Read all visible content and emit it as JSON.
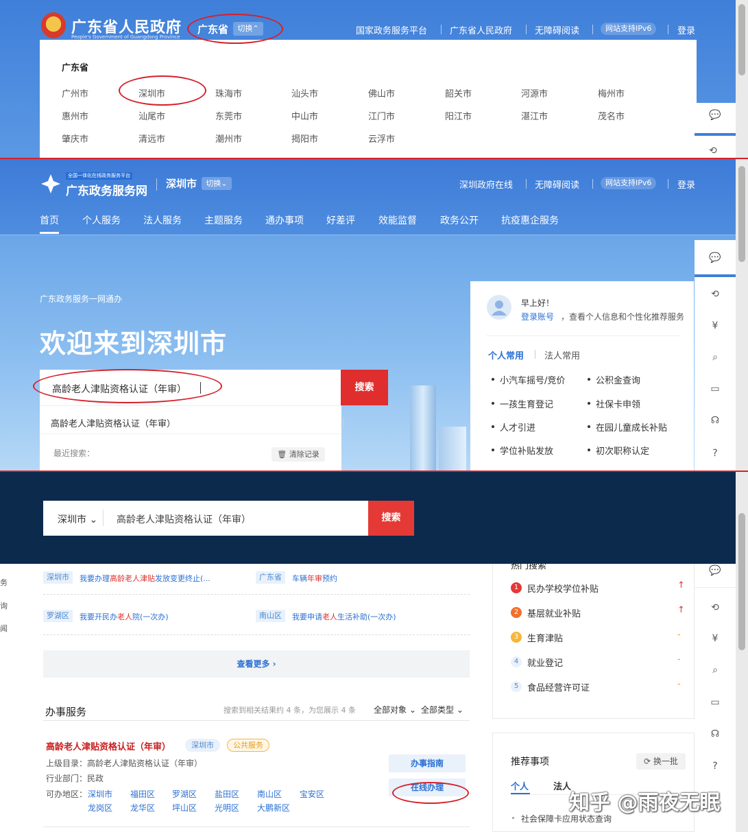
{
  "panel1": {
    "logo_title": "广东省人民政府",
    "logo_subtitle": "People's Government of Guangdong Province",
    "province_label": "广东省",
    "switch_label": "切换",
    "top_nav": [
      "国家政务服务平台",
      "广东省人民政府",
      "无障碍阅读",
      "网站支持IPv6",
      "登录"
    ],
    "dropdown_title": "广东省",
    "cities": [
      [
        "广州市",
        "深圳市",
        "珠海市",
        "汕头市",
        "佛山市",
        "韶关市",
        "河源市",
        "梅州市"
      ],
      [
        "惠州市",
        "汕尾市",
        "东莞市",
        "中山市",
        "江门市",
        "阳江市",
        "湛江市",
        "茂名市"
      ],
      [
        "肇庆市",
        "清远市",
        "潮州市",
        "揭阳市",
        "云浮市"
      ]
    ]
  },
  "panel2": {
    "logo_badge": "全国一体化在线政务服务平台",
    "logo_title": "广东政务服务网",
    "city": "深圳市",
    "switch_label": "切换",
    "top_nav": [
      "深圳政府在线",
      "无障碍阅读",
      "网站支持IPv6",
      "登录"
    ],
    "main_nav": [
      "首页",
      "个人服务",
      "法人服务",
      "主题服务",
      "通办事项",
      "好差评",
      "效能监督",
      "政务公开",
      "抗疫惠企服务"
    ],
    "slogan": "广东政务服务一网通办",
    "welcome": "欢迎来到深圳市",
    "search_value": "高龄老人津贴资格认证（年审）",
    "search_button": "搜索",
    "suggestion": "高龄老人津贴资格认证（年审）",
    "recent_label": "最近搜索：",
    "clear_label": "清除记录",
    "greeting": "早上好！",
    "login_link": "登录账号",
    "login_text": "，查看个人信息和个性化推荐服务",
    "tabs": [
      "个人常用",
      "法人常用"
    ],
    "quick_items": [
      "小汽车摇号/竞价",
      "公积金查询",
      "一孩生育登记",
      "社保卡申领",
      "人才引进",
      "在园儿童成长补贴",
      "学位补贴发放",
      "初次职称认定"
    ]
  },
  "panel3": {
    "city": "深圳市",
    "search_value": "高龄老人津贴资格认证（年审）",
    "search_button": "搜索",
    "left_cut": [
      "务",
      "询",
      "闻"
    ],
    "results": [
      {
        "tag": "深圳市",
        "pre": "我要办理",
        "hl": "高龄老人津贴",
        "post": "发放变更终止(..."
      },
      {
        "tag": "广东省",
        "pre": "车辆",
        "hl": "年审",
        "post": "预约"
      },
      {
        "tag": "罗湖区",
        "pre": "我要开民办",
        "hl": "老人",
        "post": "院(一次办)"
      },
      {
        "tag": "南山区",
        "pre": "我要申请",
        "hl": "老人",
        "post": "生活补助(一次办)"
      }
    ],
    "more_label": "查看更多 ›",
    "section_title": "办事服务",
    "section_info": "搜索到相关结果约 4 条，为您展示 4 条",
    "filter_object": "全部对象",
    "filter_type": "全部类型",
    "item_title": "高龄老人津贴资格认证（年审）",
    "item_city_pill": "深圳市",
    "item_type_pill": "公共服务",
    "parent_label": "上级目录：",
    "parent_value": "高龄老人津贴资格认证（年审）",
    "dept_label": "行业部门：",
    "dept_value": "民政",
    "areas_label": "可办地区：",
    "areas": [
      "深圳市",
      "福田区",
      "罗湖区",
      "盐田区",
      "南山区",
      "宝安区",
      "龙岗区",
      "龙华区",
      "坪山区",
      "光明区",
      "大鹏新区"
    ],
    "guide_button": "办事指南",
    "online_button": "在线办理",
    "hot_title": "热门搜索",
    "hot": [
      {
        "rank": "1",
        "text": "民办学校学位补贴",
        "trend": "↑"
      },
      {
        "rank": "2",
        "text": "基层就业补贴",
        "trend": "↑"
      },
      {
        "rank": "3",
        "text": "生育津贴",
        "trend": "-"
      },
      {
        "rank": "4",
        "text": "就业登记",
        "trend": "-"
      },
      {
        "rank": "5",
        "text": "食品经营许可证",
        "trend": "-"
      }
    ],
    "rec_title": "推荐事项",
    "rec_refresh": "换一批",
    "rec_tabs": [
      "个人",
      "法人"
    ],
    "rec_item": "社会保障卡应用状态查询"
  },
  "watermark": "知乎 @雨夜无眠",
  "colors": {
    "blue": "#3f7fd9",
    "red": "#e02d2d",
    "dark": "#0c2a4c",
    "link": "#2a6fd3"
  }
}
